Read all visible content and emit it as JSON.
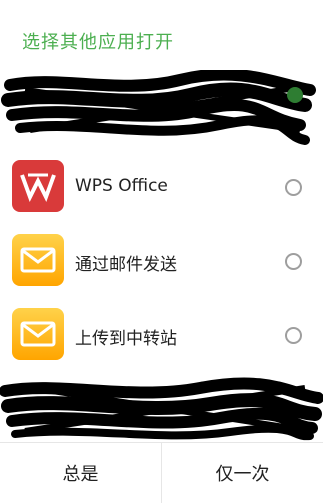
{
  "dialog": {
    "title": "选择其他应用打开",
    "accent_color": "#4caf50"
  },
  "apps": [
    {
      "label": "WPS Office",
      "icon": "wps-office-icon",
      "selected": false
    },
    {
      "label": "通过邮件发送",
      "icon": "mail-icon",
      "selected": false
    },
    {
      "label": "上传到中转站",
      "icon": "mail-icon",
      "selected": false
    }
  ],
  "footer": {
    "always_label": "总是",
    "once_label": "仅一次"
  }
}
